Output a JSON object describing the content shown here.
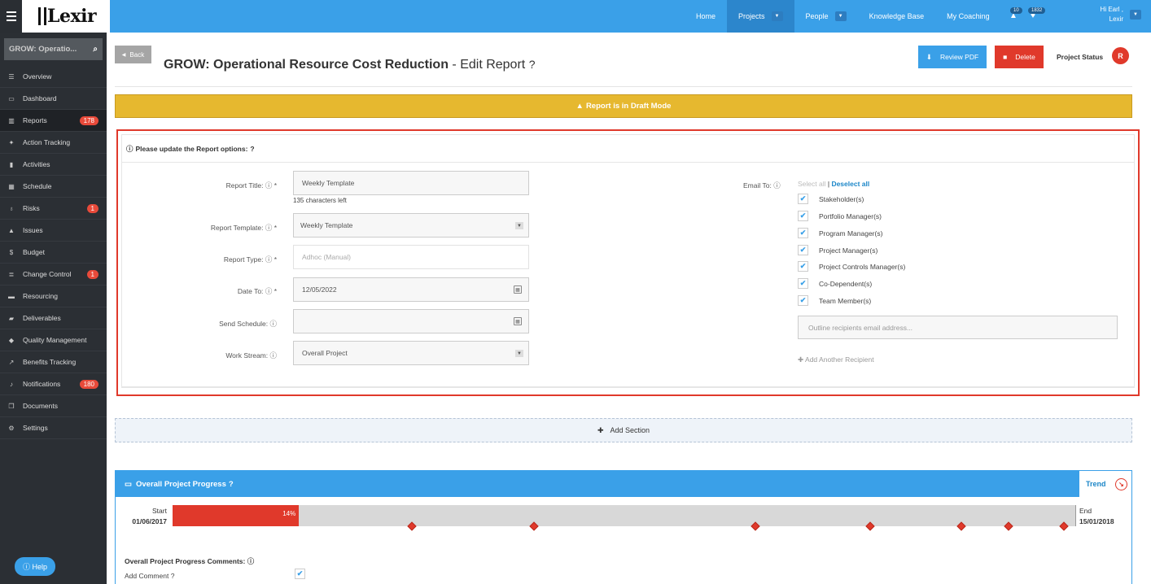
{
  "app": {
    "logo_text": "Lexir"
  },
  "topnav": {
    "items": [
      {
        "label": "Home"
      },
      {
        "label": "Projects"
      },
      {
        "label": "People"
      },
      {
        "label": "Knowledge Base"
      },
      {
        "label": "My Coaching"
      }
    ],
    "alerts_count": "10",
    "likes_count": "1832",
    "user_greeting": "Hi Earl ,",
    "user_org": "Lexir"
  },
  "sidebar": {
    "search_text": "GROW: Operatio...",
    "items": [
      {
        "label": "Overview",
        "icon": "list-icon"
      },
      {
        "label": "Dashboard",
        "icon": "dashboard-icon"
      },
      {
        "label": "Reports",
        "icon": "bar-chart-icon",
        "badge": "178"
      },
      {
        "label": "Action Tracking",
        "icon": "crosshair-icon"
      },
      {
        "label": "Activities",
        "icon": "bookmark-icon"
      },
      {
        "label": "Schedule",
        "icon": "calendar-icon"
      },
      {
        "label": "Risks",
        "icon": "lightbulb-icon",
        "badge": "1"
      },
      {
        "label": "Issues",
        "icon": "warning-icon"
      },
      {
        "label": "Budget",
        "icon": "dollar-icon"
      },
      {
        "label": "Change Control",
        "icon": "server-icon",
        "badge": "1"
      },
      {
        "label": "Resourcing",
        "icon": "folder-icon"
      },
      {
        "label": "Deliverables",
        "icon": "inbox-icon"
      },
      {
        "label": "Quality Management",
        "icon": "tag-icon"
      },
      {
        "label": "Benefits Tracking",
        "icon": "line-chart-icon"
      },
      {
        "label": "Notifications",
        "icon": "bell-icon",
        "badge": "180"
      },
      {
        "label": "Documents",
        "icon": "file-icon"
      },
      {
        "label": "Settings",
        "icon": "cogs-icon"
      }
    ],
    "help_label": "Help"
  },
  "header": {
    "back_label": "Back",
    "project_name": "GROW: Operational Resource Cost Reduction",
    "page_suffix": " - Edit Report",
    "review_pdf_label": "Review PDF",
    "delete_label": "Delete",
    "project_status_label": "Project Status",
    "project_status_value": "R"
  },
  "draft_banner": "Report is in Draft Mode",
  "options": {
    "header": "Please update the Report options:",
    "report_title_label": "Report Title:",
    "report_title_value": "Weekly Template",
    "chars_left": "135 characters left",
    "report_template_label": "Report Template:",
    "report_template_value": "Weekly Template",
    "report_type_label": "Report Type:",
    "report_type_value": "Adhoc (Manual)",
    "date_to_label": "Date To:",
    "date_to_value": "12/05/2022",
    "send_schedule_label": "Send Schedule:",
    "send_schedule_value": "",
    "work_stream_label": "Work Stream:",
    "work_stream_value": "Overall Project",
    "email_to_label": "Email To:",
    "select_all": "Select all",
    "deselect_all": "Deselect all",
    "recipients": [
      {
        "label": "Stakeholder(s)",
        "checked": true
      },
      {
        "label": "Portfolio Manager(s)",
        "checked": true
      },
      {
        "label": "Program Manager(s)",
        "checked": true
      },
      {
        "label": "Project Manager(s)",
        "checked": true
      },
      {
        "label": "Project Controls Manager(s)",
        "checked": true
      },
      {
        "label": "Co-Dependent(s)",
        "checked": true
      },
      {
        "label": "Team Member(s)",
        "checked": true
      }
    ],
    "email_placeholder": "Outline recipients email address...",
    "add_recipient": "Add Another Recipient"
  },
  "add_section_label": "Add Section",
  "progress": {
    "title": "Overall Project Progress",
    "trend_label": "Trend",
    "start_label": "Start",
    "start_date": "01/06/2017",
    "end_label": "End",
    "end_date": "15/01/2018",
    "percent": 14,
    "percent_label": "14%",
    "comments_label": "Overall Project Progress Comments:",
    "add_comment_label": "Add Comment ?"
  },
  "colors": {
    "topbar": "#3aa0e8",
    "sidebar": "#2b2f34",
    "danger": "#e0392b",
    "warning": "#e6b82f"
  }
}
